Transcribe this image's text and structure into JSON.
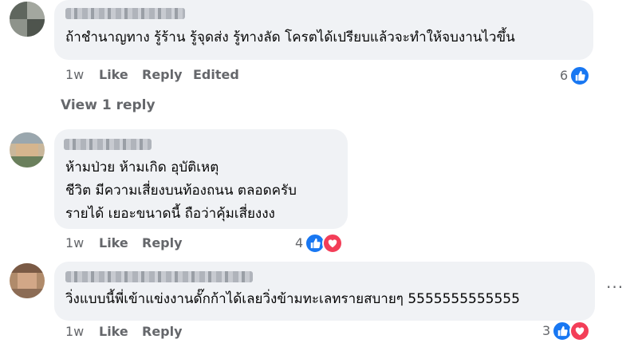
{
  "comments": [
    {
      "lines": [
        "ถ้าชำนาญทาง รู้ร้าน รู้จุดส่ง รู้ทางลัด โครตได้เปรียบแล้วจะทำให้จบงานไวขึ้น"
      ],
      "time": "1w",
      "like": "Like",
      "reply": "Reply",
      "edited": "Edited",
      "reaction_count": "6"
    },
    {
      "lines": [
        "ห้ามป่วย ห้ามเกิด อุบัติเหตุ",
        "ชีวิต มีความเสี่ยงบนท้องถนน ตลอดครับ",
        "รายได้ เยอะขนาดนี้ ถือว่าคุ้มเสี่ยงงง"
      ],
      "time": "1w",
      "like": "Like",
      "reply": "Reply",
      "reaction_count": "4"
    },
    {
      "lines": [
        "วิ่งแบบนี้พี่เข้าแข่งงานดั๊กก้าได้เลยวิ่งข้ามทะเลทรายสบายๆ 5555555555555"
      ],
      "time": "1w",
      "like": "Like",
      "reply": "Reply",
      "reaction_count": "3"
    }
  ],
  "view_replies": "View 1 reply",
  "more_options": "···",
  "icons": {
    "like": "like-reaction-icon",
    "love": "love-reaction-icon"
  },
  "colors": {
    "like": "#1877f2",
    "love": "#f33e58",
    "bubble": "#f0f2f5",
    "meta": "#65676b"
  }
}
